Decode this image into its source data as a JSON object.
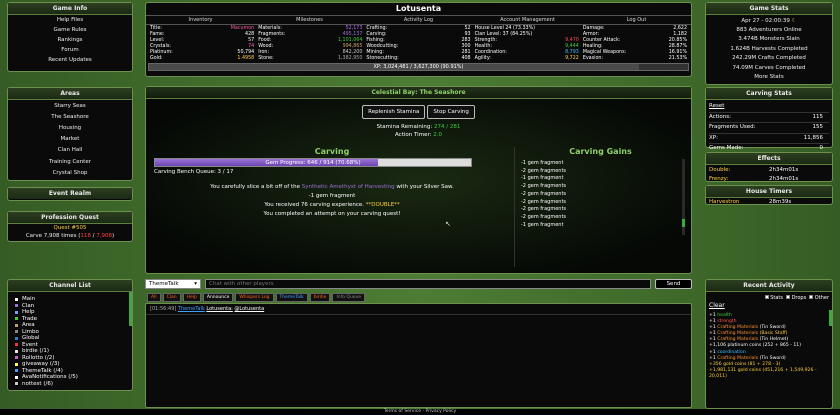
{
  "game_info": {
    "title": "Game Info",
    "items": [
      "Help Files",
      "Game Rules",
      "Rankings",
      "Forum",
      "Recent Updates"
    ]
  },
  "areas": {
    "title": "Areas",
    "items": [
      "Starry Seas",
      "The Seashore",
      "Housing",
      "Market",
      "Clan Hall",
      "Training Center",
      "Crystal Shop"
    ]
  },
  "event_realm": {
    "title": "Event Realm"
  },
  "profession_quest": {
    "title": "Profession Quest",
    "quest_id": "Quest #505",
    "progress_prefix": "Carve 7,908 times (",
    "progress_current": "118",
    "progress_sep": " / ",
    "progress_target": "7,908",
    "progress_suffix": ")"
  },
  "channels": {
    "title": "Channel List",
    "items": [
      {
        "label": "Main",
        "color": "#ffffff"
      },
      {
        "label": "Clan",
        "color": "#9a6fd8"
      },
      {
        "label": "Help",
        "color": "#7aa0ff"
      },
      {
        "label": "Trade",
        "color": "#3ccf3c"
      },
      {
        "label": "Area",
        "color": "#c8a060"
      },
      {
        "label": "Limbo",
        "color": "#888888"
      },
      {
        "label": "Global",
        "color": "#2f7fe0"
      },
      {
        "label": "Event",
        "color": "#ff3030"
      },
      {
        "label": "birdie (/1)",
        "color": "#e8e8e8"
      },
      {
        "label": "Rollotto (/2)",
        "color": "#d060d0"
      },
      {
        "label": "giveaway (/3)",
        "color": "#ffff40"
      },
      {
        "label": "ThemeTalk (/4)",
        "color": "#40a0ff"
      },
      {
        "label": "AvaNotifications (/5)",
        "color": "#ffffff"
      },
      {
        "label": "nottest (/6)",
        "color": "#cccccc"
      }
    ]
  },
  "top": {
    "player_name": "Lotusenta",
    "tabs": [
      "Inventory",
      "Milestones",
      "Activity Log",
      "Account Management",
      "Log Out"
    ],
    "col1": [
      {
        "k": "Title:",
        "v": "Macumon",
        "c": "#ff5aa0"
      },
      {
        "k": "Fame:",
        "v": "428",
        "c": "#ffffff"
      },
      {
        "k": "Level:",
        "v": "57",
        "c": "#ffffff"
      },
      {
        "k": "Crystals:",
        "v": "74",
        "c": "#ff60c0"
      },
      {
        "k": "Platinum:",
        "v": "50,794",
        "c": "#ffffff"
      },
      {
        "k": "Gold:",
        "v": "1.4958",
        "c": "#ffd040"
      }
    ],
    "col2": [
      {
        "k": "Materials:",
        "v": "52,173",
        "c": "#c06cff"
      },
      {
        "k": "Fragments:",
        "v": "495,137",
        "c": "#9a6fd8"
      },
      {
        "k": "Food:",
        "v": "1,101,064",
        "c": "#3ccf3c"
      },
      {
        "k": "Wood:",
        "v": "994,865",
        "c": "#c8a060"
      },
      {
        "k": "Iron:",
        "v": "842,200",
        "c": "#cccccc"
      },
      {
        "k": "Stone:",
        "v": "1,382,950",
        "c": "#aaaaaa"
      }
    ],
    "col3": [
      {
        "k": "Crafting:",
        "v": "52",
        "c": "#ffffff"
      },
      {
        "k": "Carving:",
        "v": "93",
        "c": "#ffffff"
      },
      {
        "k": "Fishing:",
        "v": "283",
        "c": "#ffffff"
      },
      {
        "k": "Woodcutting:",
        "v": "300",
        "c": "#ffffff"
      },
      {
        "k": "Mining:",
        "v": "281",
        "c": "#ffffff"
      },
      {
        "k": "Stonecutting:",
        "v": "408",
        "c": "#ffffff"
      }
    ],
    "col4": [
      {
        "k": "House Level 24 (73.33%)",
        "v": "",
        "c": "#ffffff"
      },
      {
        "k": "Clan Level: 37 (84.25%)",
        "v": "",
        "c": "#ffffff"
      },
      {
        "k": "Strength:",
        "v": "9,470",
        "c": "#ff5050"
      },
      {
        "k": "Health:",
        "v": "9,444",
        "c": "#3ccf3c"
      },
      {
        "k": "Coordination:",
        "v": "8,793",
        "c": "#40c0ff"
      },
      {
        "k": "Agility:",
        "v": "9,722",
        "c": "#ffd040"
      }
    ],
    "col5": [
      {
        "k": "Damage:",
        "v": "2,622",
        "c": "#ffffff"
      },
      {
        "k": "Armor:",
        "v": "1,182",
        "c": "#ffffff"
      },
      {
        "k": "Counter Attack:",
        "v": "20.85%",
        "c": "#ffffff"
      },
      {
        "k": "Healing:",
        "v": "28.87%",
        "c": "#ffffff"
      },
      {
        "k": "Magical Weapons:",
        "v": "16.91%",
        "c": "#ffffff"
      },
      {
        "k": "Evasion:",
        "v": "21.53%",
        "c": "#ffffff"
      }
    ],
    "xp_text": "XP: 3,024,481 / 3,627,300 (90.91%)",
    "xp_fraction": 0.9091
  },
  "main": {
    "location": "Celestial Bay: The Seashore",
    "replenish_label": "Replenish Stamina",
    "stop_label": "Stop Carving",
    "stamina_label": "Stamina Remaining:",
    "stamina_value": "274 / 281",
    "timer_label": "Action Timer:",
    "timer_value": "2.0",
    "carving_title": "Carving",
    "gem_progress_text": "Gem Progress: 646 / 914 (70.68%)",
    "gem_progress_fraction": 0.7068,
    "queue_text": "Carving Bench Queue: 3 / 17",
    "result_line1_a": "You carefully slice a bit off of the ",
    "result_line1_item": "Synthetic Amethyst of Harvesting",
    "result_line1_b": " with your Silver Saw.",
    "result_line2": "-1 gem fragment",
    "result_line3_a": "You received 76 carving experience. ",
    "result_line3_double": "**DOUBLE**",
    "result_line4": "You completed an attempt on your carving quest!",
    "gains_title": "Carving Gains",
    "gains": [
      "-1 gem fragment",
      "-2 gem fragments",
      "-1 gem fragment",
      "-2 gem fragments",
      "-2 gem fragments",
      "-2 gem fragments",
      "-2 gem fragments",
      "-2 gem fragments",
      "-1 gem fragment"
    ]
  },
  "chat": {
    "channel_selected": "ThemeTalk",
    "placeholder": "Chat with other players",
    "send_label": "Send",
    "chips": [
      {
        "label": "All",
        "color": "#ff6020"
      },
      {
        "label": "Clan",
        "color": "#ff6020"
      },
      {
        "label": "Help",
        "color": "#ff6020"
      },
      {
        "label": "Announce",
        "color": "#ffffff"
      },
      {
        "label": "Whispers Log",
        "color": "#ff6020"
      },
      {
        "label": "ThemeTalk",
        "color": "#40a0ff"
      },
      {
        "label": "birdie",
        "color": "#ff6020"
      },
      {
        "label": "Info Queue",
        "color": "#888888"
      }
    ],
    "message_time": "[01:56:49]",
    "message_channel": "ThemeTalk",
    "message_user": "Lotusenta:",
    "message_text": "@Lotusenta"
  },
  "game_stats": {
    "title": "Game Stats",
    "lines": [
      "Apr 27 - 02:00:39",
      "883 Adventurers Online",
      "3.474B Monsters Slain",
      "1.624B Harvests Completed",
      "242.29M Crafts Completed",
      "74.09M Carves Completed",
      "More Stats"
    ]
  },
  "carving_stats": {
    "title": "Carving Stats",
    "reset_label": "Reset",
    "rows": [
      {
        "k": "Actions:",
        "v": "115"
      },
      {
        "k": "Fragments Used:",
        "v": "155"
      },
      {
        "k": "XP:",
        "v": "11,856"
      },
      {
        "k": "Gems Made:",
        "v": "0"
      }
    ]
  },
  "effects": {
    "title": "Effects",
    "rows": [
      {
        "k": "Double:",
        "v": "2h34m01s",
        "c": "#ffd040"
      },
      {
        "k": "Frenzy:",
        "v": "2h34m01s",
        "c": "#ffd040"
      }
    ]
  },
  "house_timers": {
    "title": "House Timers",
    "rows": [
      {
        "k": "Harvestron",
        "v": "28m39s",
        "c": "#ffd040"
      }
    ]
  },
  "recent_activity": {
    "title": "Recent Activity",
    "clear_label": "Clear",
    "filters": [
      "Stats",
      "Drops",
      "Other"
    ],
    "lines": [
      {
        "parts": [
          {
            "t": "+1 ",
            "c": "#ffffff"
          },
          {
            "t": "health",
            "c": "#3ccf3c"
          }
        ]
      },
      {
        "parts": [
          {
            "t": "+1 ",
            "c": "#ffffff"
          },
          {
            "t": "strength",
            "c": "#ff5050"
          }
        ]
      },
      {
        "parts": [
          {
            "t": "+1 ",
            "c": "#ffffff"
          },
          {
            "t": "Crafting Materials",
            "c": "#ff9030"
          },
          {
            "t": " (Tin Sword)",
            "c": "#ffffff"
          }
        ]
      },
      {
        "parts": [
          {
            "t": "+1 ",
            "c": "#ffffff"
          },
          {
            "t": "Crafting Materials",
            "c": "#ff9030"
          },
          {
            "t": " (Basic Staff)",
            "c": "#ffd040"
          }
        ]
      },
      {
        "parts": [
          {
            "t": "+1 ",
            "c": "#ffffff"
          },
          {
            "t": "Crafting Materials",
            "c": "#ff9030"
          },
          {
            "t": " (Tin Helmet)",
            "c": "#ffffff"
          }
        ]
      },
      {
        "parts": [
          {
            "t": "+1,106 platinum coins (252 + 865 - 11)",
            "c": "#ffffff"
          }
        ]
      },
      {
        "parts": [
          {
            "t": "+1 ",
            "c": "#ffffff"
          },
          {
            "t": "coordination",
            "c": "#40c0ff"
          }
        ]
      },
      {
        "parts": [
          {
            "t": "+1 ",
            "c": "#ffffff"
          },
          {
            "t": "Crafting Materials",
            "c": "#ff9030"
          },
          {
            "t": " (Tin Sword)",
            "c": "#ffffff"
          }
        ]
      },
      {
        "parts": [
          {
            "t": "+356 gold coins (81 + 278 - 3)",
            "c": "#ffd040"
          }
        ]
      },
      {
        "parts": [
          {
            "t": "+1,981,131 gold coins (451,216 + 1,549,926 - 20,011)",
            "c": "#ffd040"
          }
        ]
      }
    ]
  },
  "footer": {
    "text": "Terms of Service - Privacy Policy"
  }
}
